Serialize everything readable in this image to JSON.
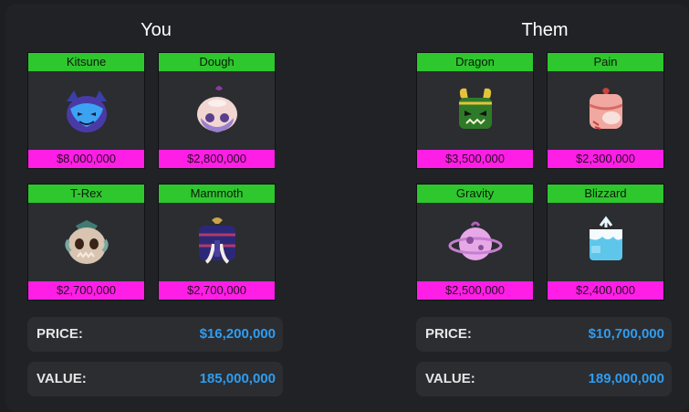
{
  "you": {
    "title": "You",
    "items": [
      {
        "name": "Kitsune",
        "price": "$8,000,000",
        "icon": "kitsune-fruit-icon"
      },
      {
        "name": "Dough",
        "price": "$2,800,000",
        "icon": "dough-fruit-icon"
      },
      {
        "name": "T-Rex",
        "price": "$2,700,000",
        "icon": "trex-fruit-icon"
      },
      {
        "name": "Mammoth",
        "price": "$2,700,000",
        "icon": "mammoth-fruit-icon"
      }
    ],
    "price_label": "PRICE:",
    "price_value": "$16,200,000",
    "value_label": "VALUE:",
    "value_value": "185,000,000"
  },
  "them": {
    "title": "Them",
    "items": [
      {
        "name": "Dragon",
        "price": "$3,500,000",
        "icon": "dragon-fruit-icon"
      },
      {
        "name": "Pain",
        "price": "$2,300,000",
        "icon": "pain-fruit-icon"
      },
      {
        "name": "Gravity",
        "price": "$2,500,000",
        "icon": "gravity-fruit-icon"
      },
      {
        "name": "Blizzard",
        "price": "$2,400,000",
        "icon": "blizzard-fruit-icon"
      }
    ],
    "price_label": "PRICE:",
    "price_value": "$10,700,000",
    "value_label": "VALUE:",
    "value_value": "189,000,000"
  },
  "colors": {
    "name_bar": "#2ec72e",
    "price_bar": "#ff1ee6",
    "stat_value": "#2f9df0"
  }
}
